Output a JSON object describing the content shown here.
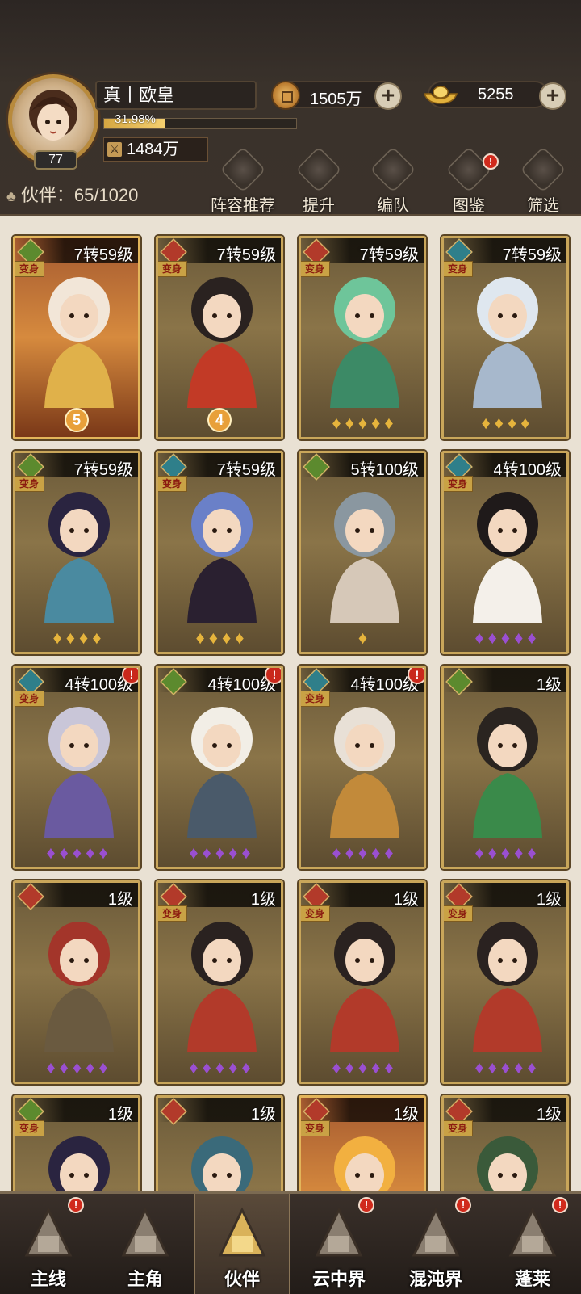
{
  "player": {
    "name": "真丨欧皇",
    "level": "77",
    "exp_percent_text": "31.98%",
    "exp_fraction": 0.3198,
    "power": "1484万"
  },
  "currencies": {
    "coins": "1505万",
    "ingots": "5255"
  },
  "partner_count": {
    "label": "伙伴",
    "value": "65/1020"
  },
  "top_buttons": [
    {
      "label": "阵容推荐",
      "alert": false
    },
    {
      "label": "提升",
      "alert": false
    },
    {
      "label": "编队",
      "alert": false
    },
    {
      "label": "图鉴",
      "alert": true
    },
    {
      "label": "筛选",
      "alert": false
    }
  ],
  "transform_label": "变身",
  "cards": [
    {
      "level": "7转59级",
      "element": "wood",
      "transform": true,
      "stars": 0,
      "star_color": "gold",
      "badge": "5",
      "alert": false,
      "theme": "red"
    },
    {
      "level": "7转59级",
      "element": "fire",
      "transform": true,
      "stars": 0,
      "star_color": "gold",
      "badge": "4",
      "alert": false,
      "theme": "brown"
    },
    {
      "level": "7转59级",
      "element": "fire",
      "transform": true,
      "stars": 5,
      "star_color": "gold",
      "badge": "",
      "alert": false,
      "theme": "brown"
    },
    {
      "level": "7转59级",
      "element": "water",
      "transform": true,
      "stars": 4,
      "star_color": "gold",
      "badge": "",
      "alert": false,
      "theme": "brown"
    },
    {
      "level": "7转59级",
      "element": "wood",
      "transform": true,
      "stars": 4,
      "star_color": "gold",
      "badge": "",
      "alert": false,
      "theme": "brown"
    },
    {
      "level": "7转59级",
      "element": "water",
      "transform": true,
      "stars": 4,
      "star_color": "gold",
      "badge": "",
      "alert": false,
      "theme": "brown"
    },
    {
      "level": "5转100级",
      "element": "wood",
      "transform": false,
      "stars": 1,
      "star_color": "gold",
      "badge": "",
      "alert": false,
      "theme": "brown"
    },
    {
      "level": "4转100级",
      "element": "water",
      "transform": true,
      "stars": 5,
      "star_color": "purple",
      "badge": "",
      "alert": false,
      "theme": "brown"
    },
    {
      "level": "4转100级",
      "element": "water",
      "transform": true,
      "stars": 5,
      "star_color": "purple",
      "badge": "",
      "alert": true,
      "theme": "brown"
    },
    {
      "level": "4转100级",
      "element": "wood",
      "transform": false,
      "stars": 5,
      "star_color": "purple",
      "badge": "",
      "alert": true,
      "theme": "brown"
    },
    {
      "level": "4转100级",
      "element": "water",
      "transform": true,
      "stars": 5,
      "star_color": "purple",
      "badge": "",
      "alert": true,
      "theme": "brown"
    },
    {
      "level": "1级",
      "element": "wood",
      "transform": false,
      "stars": 5,
      "star_color": "purple",
      "badge": "",
      "alert": false,
      "theme": "brown"
    },
    {
      "level": "1级",
      "element": "fire",
      "transform": false,
      "stars": 5,
      "star_color": "purple",
      "badge": "",
      "alert": false,
      "theme": "brown"
    },
    {
      "level": "1级",
      "element": "fire",
      "transform": true,
      "stars": 5,
      "star_color": "purple",
      "badge": "",
      "alert": false,
      "theme": "brown"
    },
    {
      "level": "1级",
      "element": "fire",
      "transform": true,
      "stars": 5,
      "star_color": "purple",
      "badge": "",
      "alert": false,
      "theme": "brown"
    },
    {
      "level": "1级",
      "element": "fire",
      "transform": true,
      "stars": 5,
      "star_color": "purple",
      "badge": "",
      "alert": false,
      "theme": "brown"
    },
    {
      "level": "1级",
      "element": "wood",
      "transform": true,
      "stars": 0,
      "star_color": "purple",
      "badge": "",
      "alert": false,
      "theme": "brown"
    },
    {
      "level": "1级",
      "element": "fire",
      "transform": false,
      "stars": 0,
      "star_color": "purple",
      "badge": "",
      "alert": false,
      "theme": "brown"
    },
    {
      "level": "1级",
      "element": "fire",
      "transform": true,
      "stars": 0,
      "star_color": "purple",
      "badge": "",
      "alert": false,
      "theme": "red"
    },
    {
      "level": "1级",
      "element": "fire",
      "transform": true,
      "stars": 0,
      "star_color": "purple",
      "badge": "",
      "alert": false,
      "theme": "brown"
    }
  ],
  "bottom_nav": [
    {
      "label": "主线",
      "alert": true,
      "active": false
    },
    {
      "label": "主角",
      "alert": false,
      "active": false
    },
    {
      "label": "伙伴",
      "alert": false,
      "active": true
    },
    {
      "label": "云中界",
      "alert": true,
      "active": false
    },
    {
      "label": "混沌界",
      "alert": true,
      "active": false
    },
    {
      "label": "蓬莱",
      "alert": true,
      "active": false
    }
  ],
  "colors": {
    "element_wood": "#5c8a2e",
    "element_fire": "#b23a2a",
    "element_water": "#2f7f8a",
    "star_gold": "#e6b43c",
    "star_purple": "#9a4fd1",
    "alert_red": "#c9281b"
  }
}
